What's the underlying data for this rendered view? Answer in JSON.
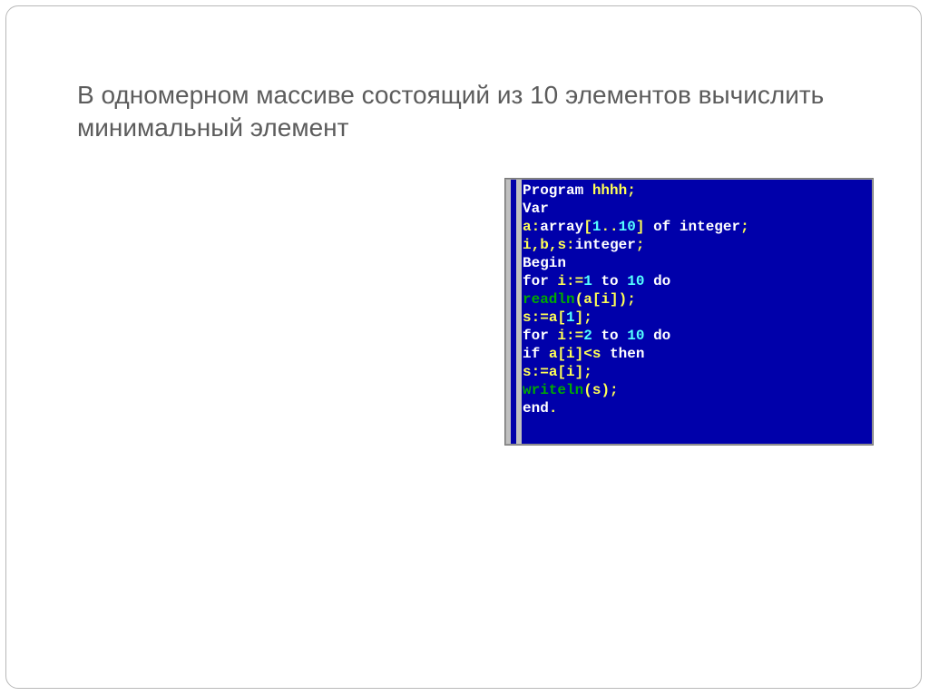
{
  "title": "В одномерном массиве  состоящий из 10 элементов вычислить минимальный элемент",
  "code": {
    "l1": {
      "kw_program": "Program",
      "name": "hhhh",
      "semi": ";"
    },
    "l2": {
      "kw_var": "Var"
    },
    "l3": {
      "a": "a",
      "colon": ":",
      "kw_array": "array",
      "lb": "[",
      "n1": "1",
      "dots": "..",
      "n10": "10",
      "rb": "]",
      "kw_of": "of",
      "typ": "integer",
      "semi": ";"
    },
    "l4": {
      "i": "i",
      "c1": ",",
      "b": "b",
      "c2": ",",
      "s": "s",
      "colon": ":",
      "typ": "integer",
      "semi": ";"
    },
    "l5": {
      "kw_begin": "Begin"
    },
    "l6": {
      "kw_for": "for",
      "i": "i",
      "assign": ":=",
      "n1": "1",
      "kw_to": "to",
      "n10": "10",
      "kw_do": "do"
    },
    "l7": {
      "fn": "readln",
      "lp": "(",
      "a": "a",
      "lb": "[",
      "i": "i",
      "rb": "]",
      "rp": ")",
      "semi": ";"
    },
    "l8": {
      "s": "s",
      "assign": ":=",
      "a": "a",
      "lb": "[",
      "n1": "1",
      "rb": "]",
      "semi": ";"
    },
    "l9": {
      "kw_for": "for",
      "i": "i",
      "assign": ":=",
      "n2": "2",
      "kw_to": "to",
      "n10": "10",
      "kw_do": "do"
    },
    "l10": {
      "kw_if": "if",
      "a": "a",
      "lb": "[",
      "i": "i",
      "rb": "]",
      "lt": "<",
      "s": "s",
      "kw_then": "then"
    },
    "l11": {
      "s": "s",
      "assign": ":=",
      "a": "a",
      "lb": "[",
      "i": "i",
      "rb": "]",
      "semi": ";"
    },
    "l12": {
      "fn": "writeln",
      "lp": "(",
      "s": "s",
      "rp": ")",
      "semi": ";"
    },
    "l13": {
      "kw_end": "end",
      "dot": "."
    }
  }
}
